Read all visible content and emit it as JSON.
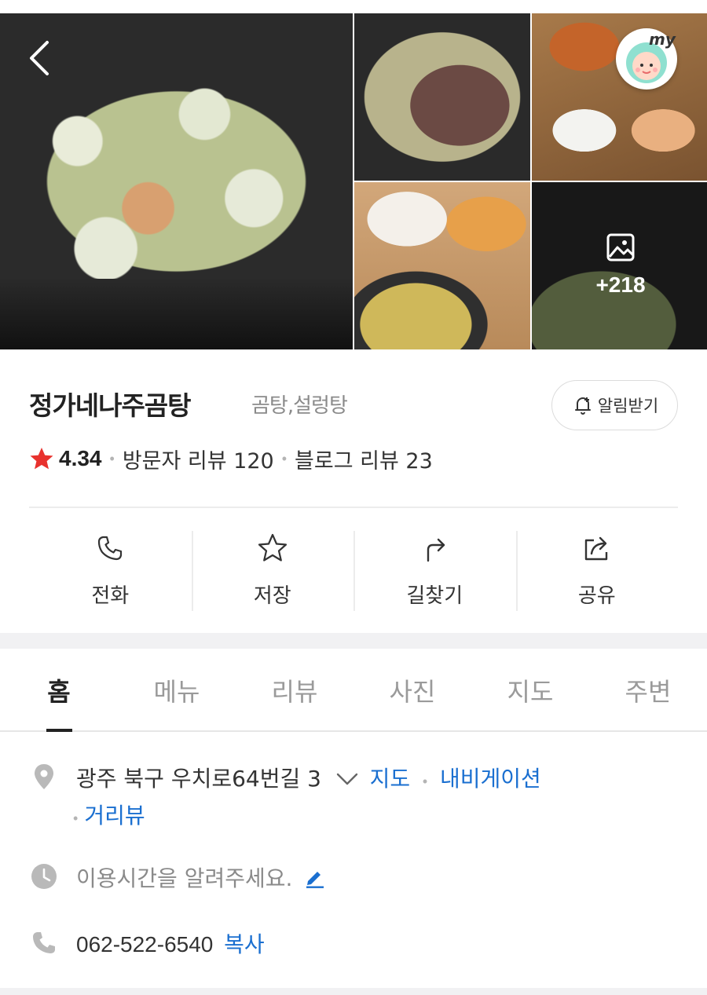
{
  "photos": {
    "more_count": "+218"
  },
  "avatar": {
    "label": "my"
  },
  "place": {
    "name": "정가네나주곰탕",
    "category": "곰탕,설렁탕",
    "alarm_label": "알림받기",
    "rating": "4.34",
    "visitor_review_label": "방문자 리뷰 120",
    "blog_review_label": "블로그 리뷰 23"
  },
  "actions": [
    {
      "label": "전화",
      "icon": "phone-icon"
    },
    {
      "label": "저장",
      "icon": "star-outline-icon"
    },
    {
      "label": "길찾기",
      "icon": "route-arrow-icon"
    },
    {
      "label": "공유",
      "icon": "share-icon"
    }
  ],
  "tabs": [
    {
      "label": "홈",
      "active": true
    },
    {
      "label": "메뉴"
    },
    {
      "label": "리뷰"
    },
    {
      "label": "사진"
    },
    {
      "label": "지도"
    },
    {
      "label": "주변"
    }
  ],
  "info": {
    "address": "광주 북구 우치로64번길 3",
    "map_link": "지도",
    "navigation_link": "내비게이션",
    "street_view_link": "거리뷰",
    "hours_prompt": "이용시간을 알려주세요.",
    "phone": "062-522-6540",
    "copy_link": "복사"
  },
  "colors": {
    "accent_link": "#1a6fd0",
    "star": "#e8322e",
    "muted_text": "#8a8a8a"
  }
}
